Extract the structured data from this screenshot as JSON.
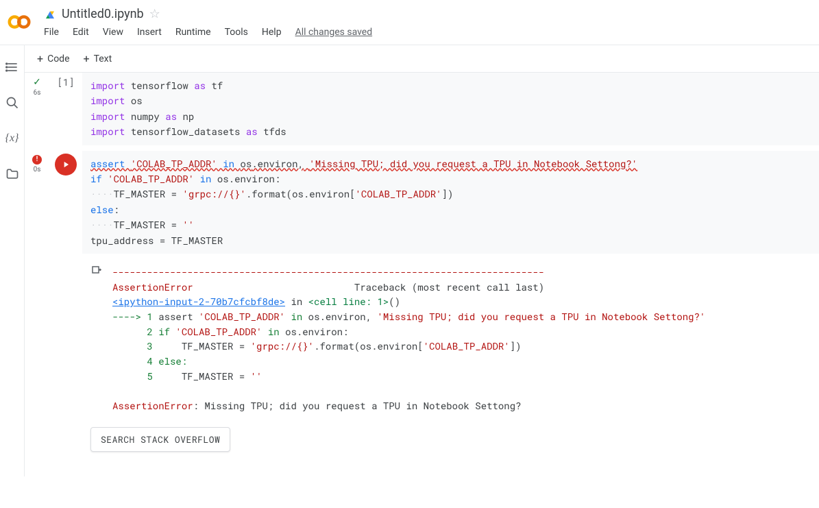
{
  "header": {
    "title": "Untitled0.ipynb",
    "menu": {
      "file": "File",
      "edit": "Edit",
      "view": "View",
      "insert": "Insert",
      "runtime": "Runtime",
      "tools": "Tools",
      "help": "Help"
    },
    "save_status": "All changes saved"
  },
  "toolbar": {
    "code_label": "Code",
    "text_label": "Text"
  },
  "cells": {
    "c1": {
      "exec_count": "[1]",
      "timing": "6s",
      "code": {
        "l1_kw": "import",
        "l1_mod": " tensorflow ",
        "l1_as": "as",
        "l1_alias": " tf",
        "l2_kw": "import",
        "l2_mod": " os",
        "l3_kw": "import",
        "l3_mod": " numpy ",
        "l3_as": "as",
        "l3_alias": " np",
        "l4_kw": "import",
        "l4_mod": " tensorflow_datasets ",
        "l4_as": "as",
        "l4_alias": " tfds"
      }
    },
    "c2": {
      "timing": "0s",
      "code": {
        "l1_assert": "assert ",
        "l1_str1": "'COLAB_TP_ADDR'",
        "l1_in": " in ",
        "l1_os": "os",
        "l1_env": ".environ,",
        "l1_sp": " ",
        "l1_str2": "'Missing TPU; did you request a TPU in Notebook Settong?'",
        "l2_if": "if ",
        "l2_str": "'COLAB_TP_ADDR'",
        "l2_in": " in ",
        "l2_os": "os",
        "l2_env": ".environ:",
        "l3_dots": "····",
        "l3_var": "TF_MASTER ",
        "l3_eq": "= ",
        "l3_str": "'grpc://{}'",
        "l3_fmt": ".format(",
        "l3_os": "os",
        "l3_env": ".environ[",
        "l3_key": "'COLAB_TP_ADDR'",
        "l3_close": "])",
        "l4_else": "else",
        "l4_colon": ":",
        "l5_dots": "····",
        "l5_var": "TF_MASTER ",
        "l5_eq": "= ",
        "l5_str": "''",
        "l6_var": "tpu_address ",
        "l6_eq": "= ",
        "l6_val": "TF_MASTER"
      },
      "output": {
        "dash": "---------------------------------------------------------------------------",
        "err_name": "AssertionError",
        "tb_label": "                            Traceback (most recent call last)",
        "frame_link": "<ipython-input-2-70b7cfcbf8de>",
        "frame_in": " in ",
        "frame_loc": "<cell line: 1>",
        "frame_paren": "()",
        "arrow": "----> 1",
        "l1": " assert ",
        "l1_s1": "'COLAB_TP_ADDR'",
        "l1_in": " in ",
        "l1_os": "os",
        "l1_env": ".environ, ",
        "l1_s2": "'Missing TPU; did you request a TPU in Notebook Settong?'",
        "n2": "      2",
        "l2": " if ",
        "l2_s": "'COLAB_TP_ADDR'",
        "l2_in": " in ",
        "l2_os": "os",
        "l2_env": ".environ:",
        "n3": "      3",
        "l3": "     TF_MASTER = ",
        "l3_s": "'grpc://{}'",
        "l3_fmt": ".format(os.environ[",
        "l3_k": "'COLAB_TP_ADDR'",
        "l3_c": "])",
        "n4": "      4",
        "l4": " else:",
        "n5": "      5",
        "l5": "     TF_MASTER = ",
        "l5_s": "''",
        "final_err": "AssertionError",
        "final_msg": ": Missing TPU; did you request a TPU in Notebook Settong?",
        "search_btn": "SEARCH STACK OVERFLOW"
      }
    }
  }
}
